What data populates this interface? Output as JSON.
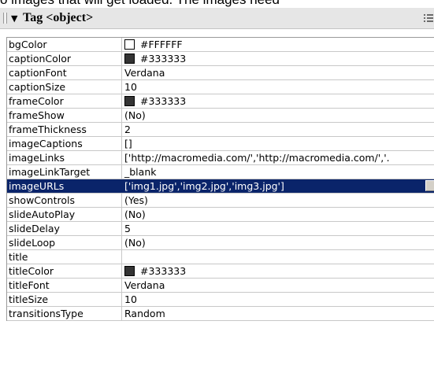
{
  "caption": "o images that will get loaded. The images need",
  "panel": {
    "title": "Tag <object>",
    "expand_arrow": "▼",
    "icons": {
      "expand": "triangle-down-icon",
      "options": "options-menu-icon"
    }
  },
  "properties": [
    {
      "name": "bgColor",
      "value": "#FFFFFF",
      "swatch": "#FFFFFF"
    },
    {
      "name": "captionColor",
      "value": "#333333",
      "swatch": "#333333"
    },
    {
      "name": "captionFont",
      "value": "Verdana"
    },
    {
      "name": "captionSize",
      "value": "10"
    },
    {
      "name": "frameColor",
      "value": "#333333",
      "swatch": "#333333"
    },
    {
      "name": "frameShow",
      "value": "(No)"
    },
    {
      "name": "frameThickness",
      "value": "2"
    },
    {
      "name": "imageCaptions",
      "value": "[]"
    },
    {
      "name": "imageLinks",
      "value": "['http://macromedia.com/','http://macromedia.com/','."
    },
    {
      "name": "imageLinkTarget",
      "value": "_blank"
    },
    {
      "name": "imageURLs",
      "value": "['img1.jpg','img2.jpg','img3.jpg']",
      "selected": true
    },
    {
      "name": "showControls",
      "value": "(Yes)"
    },
    {
      "name": "slideAutoPlay",
      "value": "(No)"
    },
    {
      "name": "slideDelay",
      "value": "5"
    },
    {
      "name": "slideLoop",
      "value": "(No)"
    },
    {
      "name": "title",
      "value": ""
    },
    {
      "name": "titleColor",
      "value": "#333333",
      "swatch": "#333333"
    },
    {
      "name": "titleFont",
      "value": "Verdana"
    },
    {
      "name": "titleSize",
      "value": "10"
    },
    {
      "name": "transitionsType",
      "value": "Random"
    }
  ],
  "colors": {
    "selection": "#0a246a",
    "header": "#e6e6e6"
  }
}
